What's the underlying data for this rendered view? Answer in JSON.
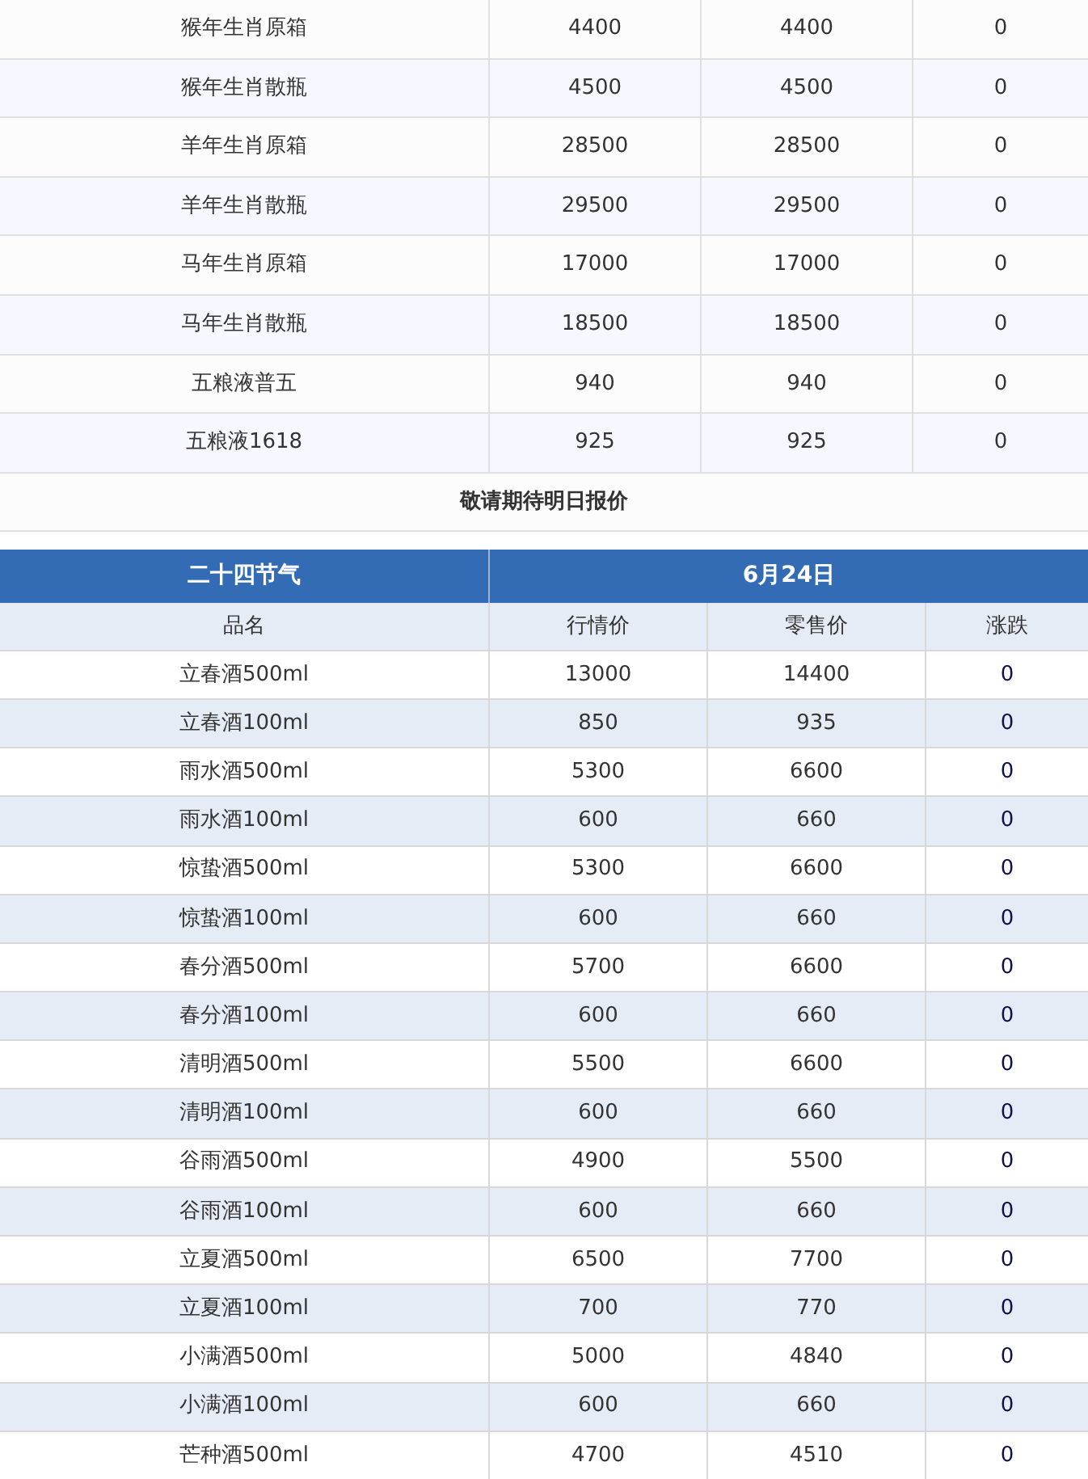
{
  "top_table": {
    "rows": [
      {
        "cells": [
          "猴年生肖原箱",
          "4400",
          "4400",
          "0"
        ]
      },
      {
        "cells": [
          "猴年生肖散瓶",
          "4500",
          "4500",
          "0"
        ]
      },
      {
        "cells": [
          "羊年生肖原箱",
          "28500",
          "28500",
          "0"
        ]
      },
      {
        "cells": [
          "羊年生肖散瓶",
          "29500",
          "29500",
          "0"
        ]
      },
      {
        "cells": [
          "马年生肖原箱",
          "17000",
          "17000",
          "0"
        ]
      },
      {
        "cells": [
          "马年生肖散瓶",
          "18500",
          "18500",
          "0"
        ]
      },
      {
        "cells": [
          "五粮液普五",
          "940",
          "940",
          "0"
        ]
      },
      {
        "cells": [
          "五粮液1618",
          "925",
          "925",
          "0"
        ]
      }
    ],
    "note": "敬请期待明日报价"
  },
  "bottom_table": {
    "title": "二十四节气",
    "date": "6月24日",
    "columns": [
      "品名",
      "行情价",
      "零售价",
      "涨跌"
    ],
    "rows": [
      {
        "cells": [
          "立春酒500ml",
          "13000",
          "14400",
          "0"
        ]
      },
      {
        "cells": [
          "立春酒100ml",
          "850",
          "935",
          "0"
        ]
      },
      {
        "cells": [
          "雨水酒500ml",
          "5300",
          "6600",
          "0"
        ]
      },
      {
        "cells": [
          "雨水酒100ml",
          "600",
          "660",
          "0"
        ]
      },
      {
        "cells": [
          "惊蛰酒500ml",
          "5300",
          "6600",
          "0"
        ]
      },
      {
        "cells": [
          "惊蛰酒100ml",
          "600",
          "660",
          "0"
        ]
      },
      {
        "cells": [
          "春分酒500ml",
          "5700",
          "6600",
          "0"
        ]
      },
      {
        "cells": [
          "春分酒100ml",
          "600",
          "660",
          "0"
        ]
      },
      {
        "cells": [
          "清明酒500ml",
          "5500",
          "6600",
          "0"
        ]
      },
      {
        "cells": [
          "清明酒100ml",
          "600",
          "660",
          "0"
        ]
      },
      {
        "cells": [
          "谷雨酒500ml",
          "4900",
          "5500",
          "0"
        ]
      },
      {
        "cells": [
          "谷雨酒100ml",
          "600",
          "660",
          "0"
        ]
      },
      {
        "cells": [
          "立夏酒500ml",
          "6500",
          "7700",
          "0"
        ]
      },
      {
        "cells": [
          "立夏酒100ml",
          "700",
          "770",
          "0"
        ]
      },
      {
        "cells": [
          "小满酒500ml",
          "5000",
          "4840",
          "0"
        ]
      },
      {
        "cells": [
          "小满酒100ml",
          "600",
          "660",
          "0"
        ]
      },
      {
        "cells": [
          "芒种酒500ml",
          "4700",
          "4510",
          "0"
        ]
      }
    ]
  }
}
